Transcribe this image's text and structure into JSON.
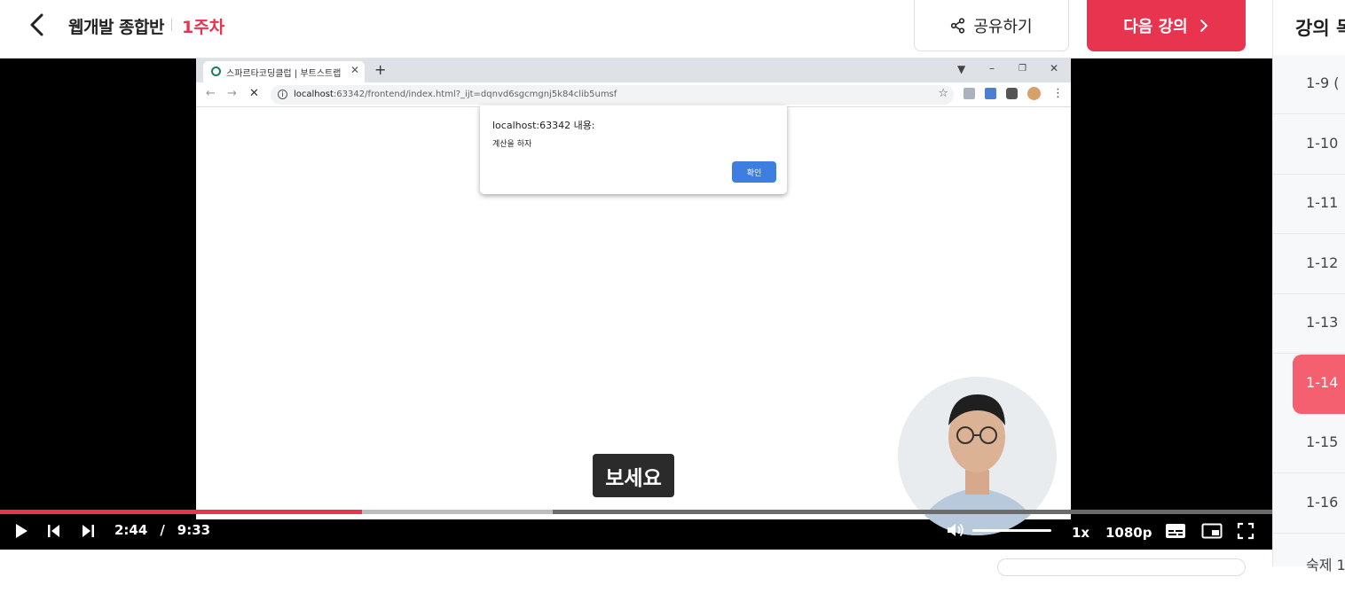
{
  "header": {
    "course_title": "웹개발 종합반",
    "week": "1주차",
    "share_label": "공유하기",
    "next_label": "다음 강의"
  },
  "browser": {
    "tab_title": "스파르타코딩클럽 | 부트스트랩",
    "url_host": "localhost",
    "url_rest": ":63342/frontend/index.html?_ijt=dqnvd6sgcmgnj5k84clib5umsf",
    "alert": {
      "title": "localhost:63342 내용:",
      "message": "계산을 하자",
      "ok_label": "확인"
    }
  },
  "player": {
    "caption": "보세요",
    "current_time": "2:44",
    "separator": "/",
    "duration": "9:33",
    "played_fraction": 0.2846,
    "buffered_fraction": 0.4344,
    "volume_fraction": 1.0,
    "playback_rate": "1x",
    "quality": "1080p"
  },
  "sidebar": {
    "title": "강의 목",
    "lessons": [
      {
        "label": "1-9  ("
      },
      {
        "label": "1-10"
      },
      {
        "label": "1-11"
      },
      {
        "label": "1-12"
      },
      {
        "label": "1-13"
      },
      {
        "label": "1-14"
      },
      {
        "label": "1-15"
      },
      {
        "label": "1-16"
      },
      {
        "label": "숙제  1"
      }
    ],
    "active_index": 5
  },
  "colors": {
    "accent": "#e8344e",
    "active_lesson": "#f56070"
  }
}
